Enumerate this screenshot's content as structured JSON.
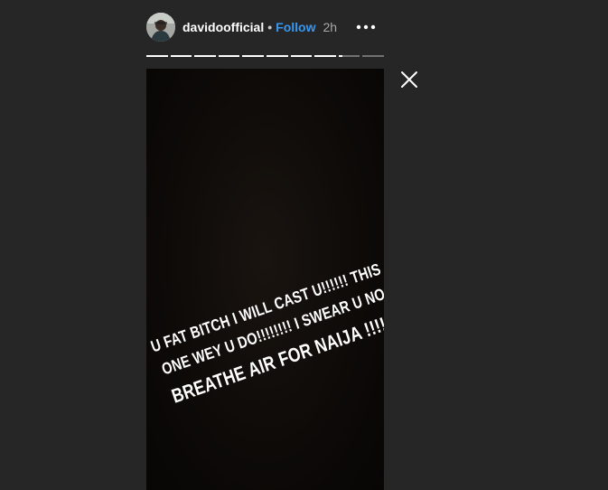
{
  "header": {
    "username": "davidoofficial",
    "separator": "•",
    "follow_label": "Follow",
    "time": "2h"
  },
  "story": {
    "total_segments": 10,
    "segments": [
      1,
      1,
      1,
      1,
      1,
      1,
      1,
      1,
      0.2,
      0
    ],
    "caption_lines": [
      "U FAT BITCH I WILL CAST U!!!!!! THIS",
      "ONE WEY U DO!!!!!!!! I SWEAR U NO",
      "BREATHE AIR FOR NAIJA !!!!!!!!"
    ]
  },
  "colors": {
    "background": "#262626",
    "follow": "#3897f0",
    "text": "#ffffff"
  },
  "icons": {
    "more": "more-options-icon",
    "close": "close-icon"
  }
}
